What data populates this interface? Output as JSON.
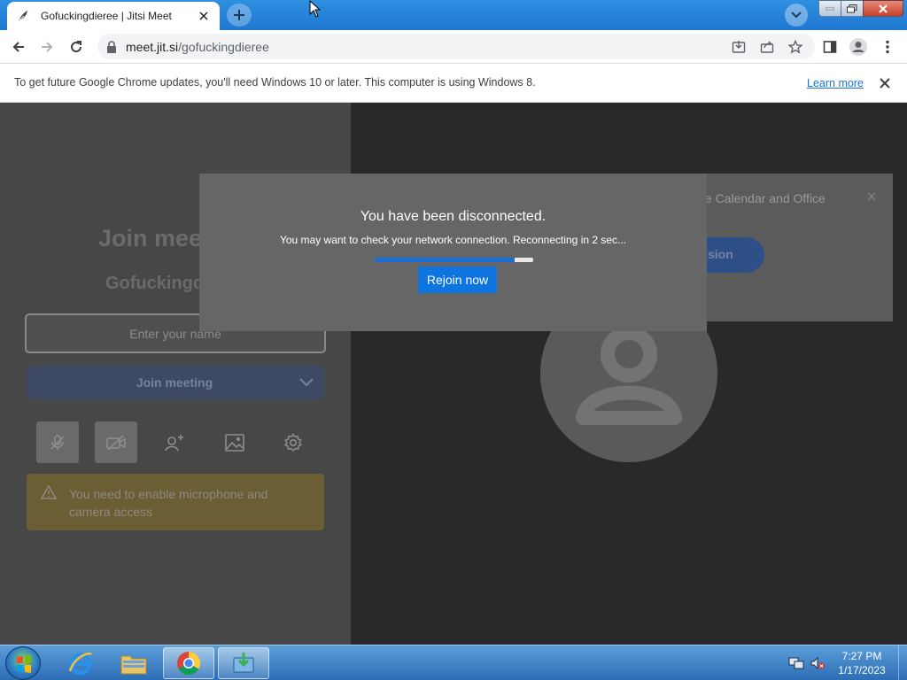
{
  "browser": {
    "tab_title": "Gofuckingdieree | Jitsi Meet",
    "url_host": "meet.jit.si",
    "url_path": "/gofuckingdieree"
  },
  "infobar": {
    "message": "To get future Google Chrome updates, you'll need Windows 10 or later. This computer is using Windows 8.",
    "learn_more": "Learn more"
  },
  "prejoin": {
    "title": "Join mee",
    "room_name": "Gofuckingd",
    "name_placeholder": "Enter your name",
    "join_button": "Join meeting",
    "warning": "You need to enable microphone and camera access"
  },
  "calendar_banner": {
    "text": "gle Calendar and Office",
    "button": "sion"
  },
  "dialog": {
    "title": "You have been disconnected.",
    "message": "You may want to check your network connection. Reconnecting in 2 sec...",
    "progress": 0.88,
    "rejoin_button": "Rejoin now"
  },
  "taskbar": {
    "time": "7:27 PM",
    "date": "1/17/2023"
  },
  "colors": {
    "chrome_accent": "#1f78d1",
    "jitsi_primary": "#0e74e0",
    "warning_bg": "#6b5e34"
  }
}
